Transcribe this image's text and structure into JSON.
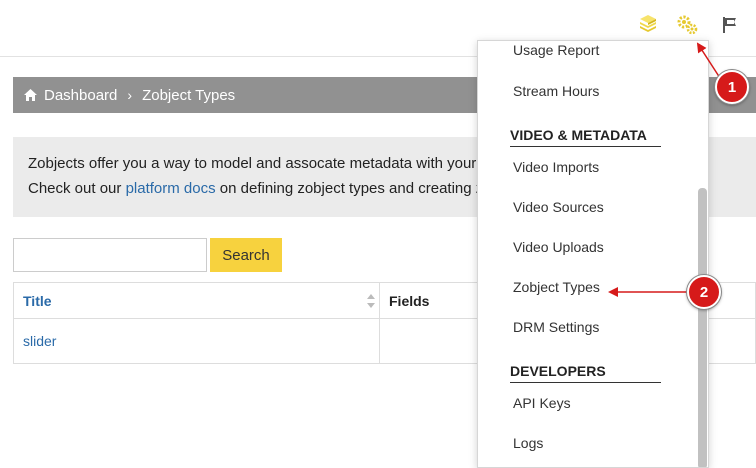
{
  "header": {
    "icons": [
      "stack-icon",
      "gears-icon",
      "flag-icon"
    ]
  },
  "breadcrumb": {
    "home_label": "Dashboard",
    "separator": "›",
    "current": "Zobject Types"
  },
  "info": {
    "line1": "Zobjects offer you a way to model and assocate metadata with your v",
    "line2_prefix": "Check out our ",
    "line2_link": "platform docs",
    "line2_suffix": " on defining zobject types and creating z"
  },
  "search": {
    "placeholder": "",
    "value": "",
    "button_label": "Search"
  },
  "table": {
    "columns": [
      "Title",
      "Fields"
    ],
    "rows": [
      {
        "title": "slider",
        "fields": ""
      }
    ]
  },
  "dropdown": {
    "partial_top_item": "Usage Report",
    "items_analytics": [
      "Stream Hours"
    ],
    "section_video": "VIDEO & METADATA",
    "items_video": [
      "Video Imports",
      "Video Sources",
      "Video Uploads",
      "Zobject Types",
      "DRM Settings"
    ],
    "section_developers": "DEVELOPERS",
    "items_developers": [
      "API Keys",
      "Logs"
    ]
  },
  "annotations": {
    "badge1": "1",
    "badge2": "2",
    "color": "#d61a1a"
  }
}
